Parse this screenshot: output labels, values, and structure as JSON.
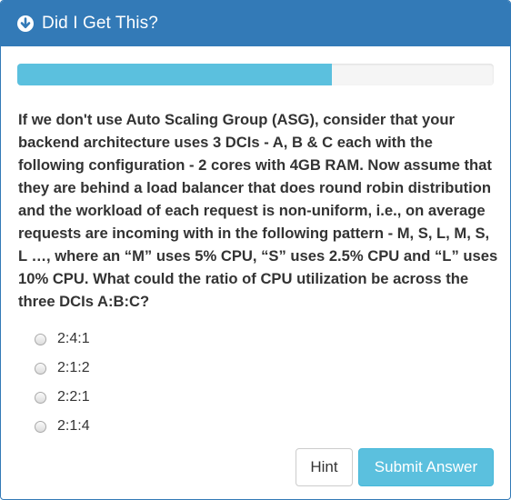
{
  "header": {
    "title": "Did I Get This?",
    "icon": "arrow-circle-down-icon"
  },
  "progress": {
    "fraction": 0.66,
    "color": "#5bc0de"
  },
  "question": {
    "text": "If we don't use Auto Scaling Group (ASG), consider that your backend architecture uses 3 DCIs - A, B & C each with the following configuration - 2 cores with 4GB RAM. Now assume that they are behind a load balancer that does round robin distribution and the workload of each request is non-uniform, i.e., on average requests are incoming with in the following pattern - M, S, L, M, S, L …, where an “M” uses 5% CPU, “S” uses 2.5% CPU and “L” uses 10% CPU. What could the ratio of CPU utilization be across the three DCIs A:B:C?"
  },
  "options": [
    {
      "label": "2:4:1",
      "selected": false
    },
    {
      "label": "2:1:2",
      "selected": false
    },
    {
      "label": "2:2:1",
      "selected": false
    },
    {
      "label": "2:1:4",
      "selected": false
    }
  ],
  "buttons": {
    "hint_label": "Hint",
    "submit_label": "Submit Answer"
  },
  "colors": {
    "header": "#337ab7",
    "submit": "#5bc0de"
  }
}
